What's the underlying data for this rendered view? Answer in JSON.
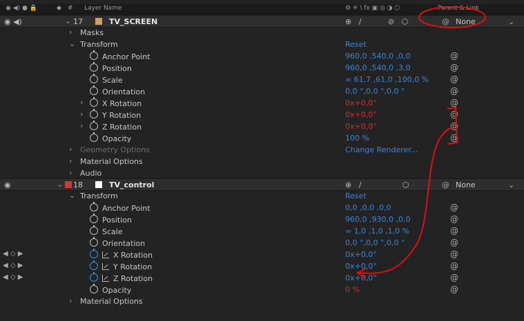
{
  "header": {
    "col_hash": "#",
    "col_layer_name": "Layer Name",
    "col_switches": "⚙ ✳ \\ fx ▣ ◎ ◑ ⬡",
    "col_parent": "Parent & Link"
  },
  "layers": [
    {
      "number": "17",
      "name": "TV_SCREEN",
      "parent": "None"
    },
    {
      "number": "18",
      "name": "TV_control",
      "parent": "None"
    }
  ],
  "layer17": {
    "masks": "Masks",
    "transform": "Transform",
    "reset": "Reset",
    "props": [
      {
        "label": "Anchor Point",
        "value": "960,0 ,540,0 ,0,0"
      },
      {
        "label": "Position",
        "value": "960,0 ,540,0 ,3,0"
      },
      {
        "label": "Scale",
        "value": "∞ 61,7 ,61,0 ,100,0 %"
      },
      {
        "label": "Orientation",
        "value": "0,0 °,0,0 °,0,0 °"
      },
      {
        "label": "X Rotation",
        "value": "0x+0,0°"
      },
      {
        "label": "Y Rotation",
        "value": "0x+0,0°"
      },
      {
        "label": "Z Rotation",
        "value": "0x+0,0°"
      },
      {
        "label": "Opacity",
        "value": "100 %"
      }
    ],
    "geometry": "Geometry Options",
    "change_renderer": "Change Renderer...",
    "material": "Material Options",
    "audio": "Audio"
  },
  "layer18": {
    "transform": "Transform",
    "reset": "Reset",
    "props": [
      {
        "label": "Anchor Point",
        "value": "0,0 ,0,0 ,0,0"
      },
      {
        "label": "Position",
        "value": "960,0 ,930,0 ,0,0"
      },
      {
        "label": "Scale",
        "value": "∞ 1,0 ,1,0 ,1,0 %"
      },
      {
        "label": "Orientation",
        "value": "0,0 °,0,0 °,0,0 °"
      },
      {
        "label": "X Rotation",
        "value": "0x+0,0°"
      },
      {
        "label": "Y Rotation",
        "value": "0x+0,0°"
      },
      {
        "label": "Z Rotation",
        "value": "0x+0,0°"
      },
      {
        "label": "Opacity",
        "value": "0 %"
      }
    ],
    "material": "Material Options"
  },
  "colors": {
    "accent_blue": "#3a87d6",
    "red": "#d23030",
    "layer17_swatch": "#c9a26b",
    "layer18_swatch": "#c93b3b",
    "annotation": "#e01010"
  }
}
